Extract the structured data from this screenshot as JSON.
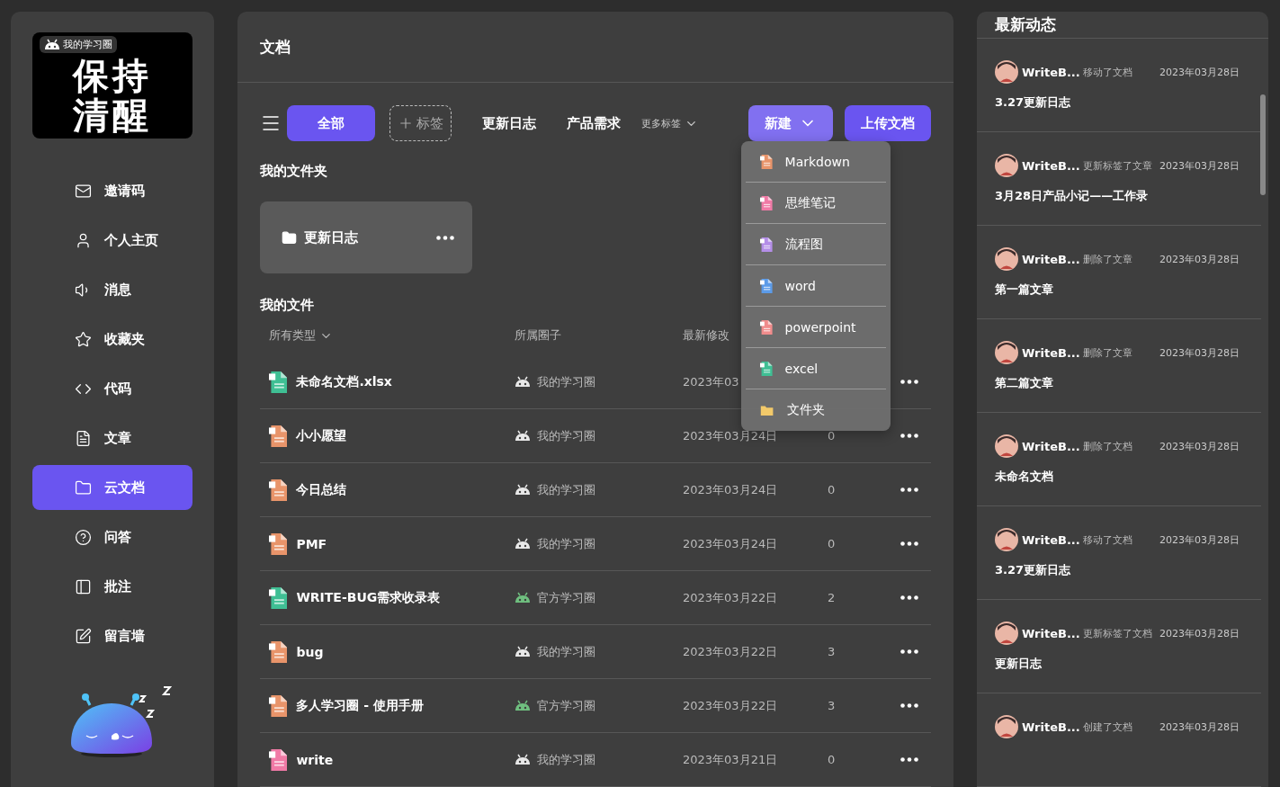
{
  "sidebar": {
    "logo": {
      "lines": [
        "保持",
        "清醒"
      ],
      "badge": "我的学习圈"
    },
    "items": [
      {
        "label": "邀请码",
        "kind": "mail",
        "selected": false
      },
      {
        "label": "个人主页",
        "kind": "user",
        "selected": false
      },
      {
        "label": "消息",
        "kind": "speaker",
        "selected": false
      },
      {
        "label": "收藏夹",
        "kind": "star",
        "selected": false
      },
      {
        "label": "代码",
        "kind": "code",
        "selected": false
      },
      {
        "label": "文章",
        "kind": "doc",
        "selected": false
      },
      {
        "label": "云文档",
        "kind": "folder",
        "selected": true
      },
      {
        "label": "问答",
        "kind": "help",
        "selected": false
      },
      {
        "label": "批注",
        "kind": "panel",
        "selected": false
      },
      {
        "label": "留言墙",
        "kind": "edit",
        "selected": false
      }
    ]
  },
  "main": {
    "title": "文档",
    "tags": [
      {
        "label": "全部",
        "selected": true
      },
      {
        "label": "更新日志",
        "selected": false
      },
      {
        "label": "产品需求",
        "selected": false
      }
    ],
    "add_tag": "标签",
    "more_tags": "更多标签",
    "new_button": "新建",
    "upload_button": "上传文档",
    "new_menu": [
      {
        "label": "Markdown",
        "kind": "markdown"
      },
      {
        "label": "思维笔记",
        "kind": "mind"
      },
      {
        "label": "流程图",
        "kind": "flow"
      },
      {
        "label": "word",
        "kind": "word"
      },
      {
        "label": "powerpoint",
        "kind": "ppt"
      },
      {
        "label": "excel",
        "kind": "excel"
      },
      {
        "label": "文件夹",
        "kind": "folder"
      }
    ],
    "folders_title": "我的文件夹",
    "folders": [
      {
        "name": "更新日志"
      }
    ],
    "files_title": "我的文件",
    "columns": [
      "所有类型",
      "所属圈子",
      "最新修改"
    ],
    "files": [
      {
        "name": "未命名文档.xlsx",
        "kind": "excel",
        "circle": {
          "label": "我的学习圈",
          "color": "#e8e8e8"
        },
        "modified": "2023年03"
      },
      {
        "name": "小小愿望",
        "kind": "markdown",
        "circle": {
          "label": "我的学习圈",
          "color": "#e8e8e8"
        },
        "modified": "2023年03月24日",
        "count": "0"
      },
      {
        "name": "今日总结",
        "kind": "markdown",
        "circle": {
          "label": "我的学习圈",
          "color": "#e8e8e8"
        },
        "modified": "2023年03月24日",
        "count": "0"
      },
      {
        "name": "PMF",
        "kind": "markdown",
        "circle": {
          "label": "我的学习圈",
          "color": "#e8e8e8"
        },
        "modified": "2023年03月24日",
        "count": "0"
      },
      {
        "name": "WRITE-BUG需求收录表",
        "kind": "excel",
        "circle": {
          "label": "官方学习圈",
          "color": "#6fbf7f"
        },
        "modified": "2023年03月22日",
        "count": "2"
      },
      {
        "name": "bug",
        "kind": "markdown",
        "circle": {
          "label": "我的学习圈",
          "color": "#e8e8e8"
        },
        "modified": "2023年03月22日",
        "count": "3"
      },
      {
        "name": "多人学习圈 - 使用手册",
        "kind": "markdown",
        "circle": {
          "label": "官方学习圈",
          "color": "#6fbf7f"
        },
        "modified": "2023年03月22日",
        "count": "3"
      },
      {
        "name": "write",
        "kind": "mind",
        "circle": {
          "label": "我的学习圈",
          "color": "#e8e8e8"
        },
        "modified": "2023年03月21日",
        "count": "0"
      }
    ]
  },
  "activity": {
    "title": "最新动态",
    "items": [
      {
        "user": "WriteB...",
        "action": "移动了文档",
        "date": "2023年03月28日",
        "doc": "3.27更新日志"
      },
      {
        "user": "WriteB...",
        "action": "更新标签了文章",
        "date": "2023年03月28日",
        "doc": "3月28日产品小记——工作录"
      },
      {
        "user": "WriteB...",
        "action": "删除了文章",
        "date": "2023年03月28日",
        "doc": "第一篇文章"
      },
      {
        "user": "WriteB...",
        "action": "删除了文章",
        "date": "2023年03月28日",
        "doc": "第二篇文章"
      },
      {
        "user": "WriteB...",
        "action": "删除了文档",
        "date": "2023年03月28日",
        "doc": "未命名文档"
      },
      {
        "user": "WriteB...",
        "action": "移动了文档",
        "date": "2023年03月28日",
        "doc": "3.27更新日志"
      },
      {
        "user": "WriteB...",
        "action": "更新标签了文档",
        "date": "2023年03月28日",
        "doc": "更新日志"
      },
      {
        "user": "WriteB...",
        "action": "创建了文档",
        "date": "2023年03月28日"
      }
    ]
  }
}
